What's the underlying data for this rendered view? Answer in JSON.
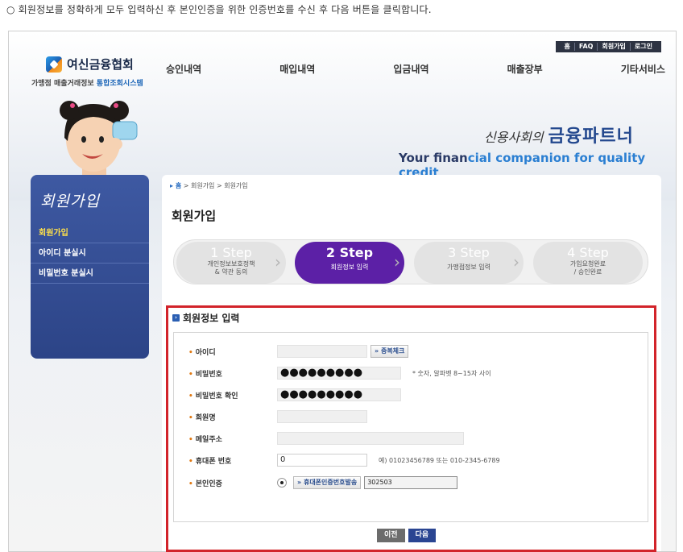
{
  "instruction": "○ 회원정보를 정확하게 모두 입력하신 후 본인인증을 위한 인증번호를 수신 후 다음 버튼을 클릭합니다.",
  "util_nav": [
    "홈",
    "FAQ",
    "회원가입",
    "로그인"
  ],
  "logo": {
    "title": "여신금융협회",
    "sub_prefix": "가맹점 매출거래정보 ",
    "sub_accent": "통합조회시스템"
  },
  "gnb": [
    "승인내역",
    "매입내역",
    "입금내역",
    "매출장부",
    "기타서비스"
  ],
  "slogan": {
    "ko_small": "신용사회의",
    "ko_big": "금융파트너",
    "en_prefix": "Your finan",
    "en_accent": "cial companion for quality credit"
  },
  "sidebar": {
    "title": "회원가입",
    "items": [
      {
        "label": "회원가입",
        "active": true
      },
      {
        "label": "아이디 분실시",
        "active": false
      },
      {
        "label": "비밀번호 분실시",
        "active": false
      }
    ]
  },
  "breadcrumb": {
    "home": "홈",
    "rest": " > 회원가입 > 회원가입"
  },
  "page_title": "회원가입",
  "steps": [
    {
      "no": "1 Step",
      "label1": "개인정보보호정책",
      "label2": "& 약관 동의",
      "active": false
    },
    {
      "no": "2 Step",
      "label1": "회원정보 입력",
      "label2": "",
      "active": true
    },
    {
      "no": "3 Step",
      "label1": "가맹점정보 입력",
      "label2": "",
      "active": false
    },
    {
      "no": "4 Step",
      "label1": "가입요청완료",
      "label2": "/ 승인완료",
      "active": false
    }
  ],
  "form": {
    "title": "회원정보 입력",
    "id_label": "아이디",
    "id_value": "",
    "dup_check_label": "중복체크",
    "pw_label": "비밀번호",
    "pw_value": "●●●●●●●●●",
    "pw_hint": "* 숫자, 알파벳 8~15자 사이",
    "pw_confirm_label": "비밀번호 확인",
    "pw_confirm_value": "●●●●●●●●●",
    "name_label": "회원명",
    "name_value": "",
    "email_label": "메일주소",
    "email_value": "",
    "phone_label": "휴대폰 번호",
    "phone_value": "0",
    "phone_hint": "예) 01023456789 또는 010-2345-6789",
    "auth_label": "본인인증",
    "send_code_label": "휴대폰인증번호발송",
    "auth_code": "302503",
    "prev_label": "이전",
    "next_label": "다음"
  },
  "colors": {
    "accent": "#5c20a6",
    "highlight_border": "#d2232a",
    "sidebar": "#34509a"
  }
}
